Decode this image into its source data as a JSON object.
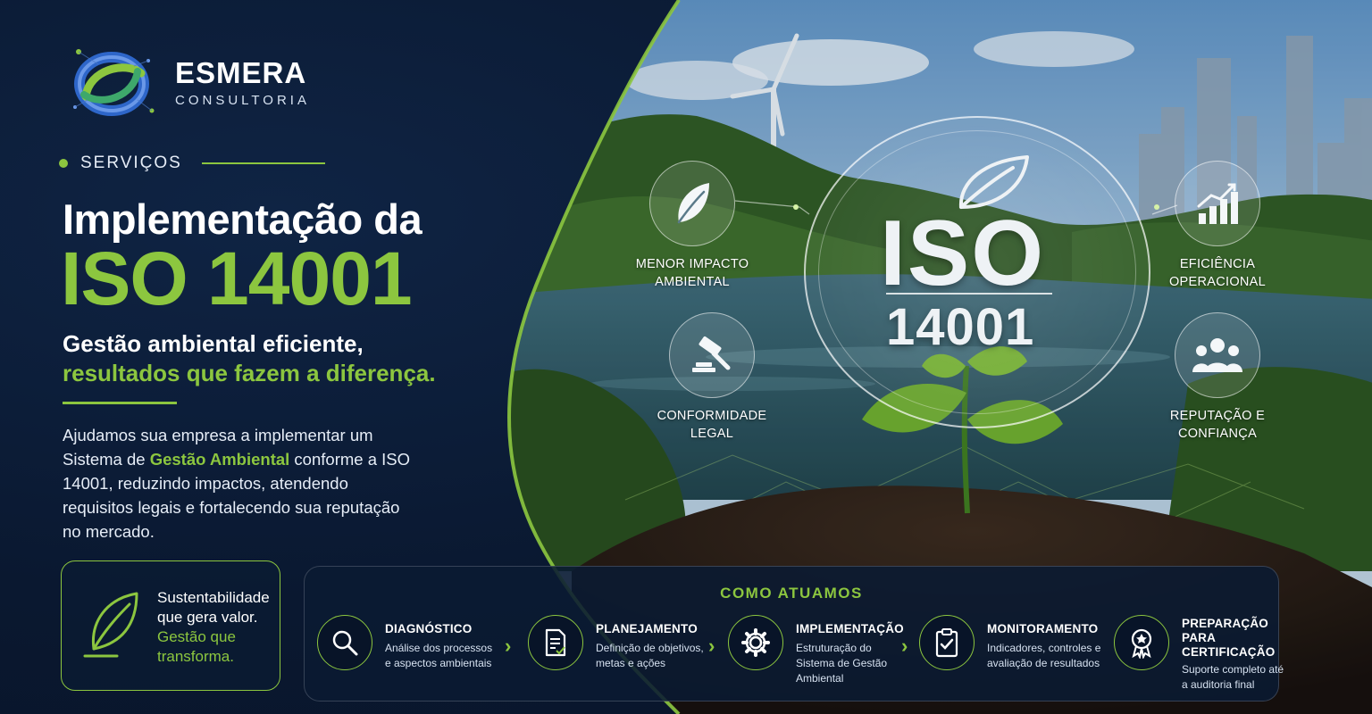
{
  "brand": {
    "name": "ESMERA",
    "tagline": "CONSULTORIA"
  },
  "hero": {
    "eyebrow": "SERVIÇOS",
    "title_line1": "Implementação da",
    "title_line2": "ISO 14001",
    "subtitle_line1": "Gestão ambiental eficiente,",
    "subtitle_line2": "resultados que fazem a diferença.",
    "paragraph_before": "Ajudamos sua empresa a implementar um Sistema de ",
    "paragraph_highlight": "Gestão Ambiental",
    "paragraph_after": " conforme a ISO 14001, reduzindo impactos, atendendo requisitos legais e fortalecendo sua reputação no mercado."
  },
  "sustainability_card": {
    "line1": "Sustentabilidade que gera valor.",
    "line2": "Gestão que transforma.",
    "icon": "leaf-icon"
  },
  "badge": {
    "word": "ISO",
    "number": "14001"
  },
  "benefits": [
    {
      "label": "MENOR IMPACTO AMBIENTAL",
      "icon": "leaf-icon"
    },
    {
      "label": "CONFORMIDADE LEGAL",
      "icon": "gavel-icon"
    },
    {
      "label": "EFICIÊNCIA OPERACIONAL",
      "icon": "growth-chart-icon"
    },
    {
      "label": "REPUTAÇÃO E CONFIANÇA",
      "icon": "people-icon"
    }
  ],
  "process": {
    "title": "COMO ATUAMOS",
    "steps": [
      {
        "name": "DIAGNÓSTICO",
        "desc": "Análise dos processos e aspectos ambientais",
        "icon": "search-icon"
      },
      {
        "name": "PLANEJAMENTO",
        "desc": "Definição de objetivos, metas e ações",
        "icon": "document-icon"
      },
      {
        "name": "IMPLEMENTAÇÃO",
        "desc": "Estruturação do Sistema de Gestão Ambiental",
        "icon": "gear-icon"
      },
      {
        "name": "MONITORAMENTO",
        "desc": "Indicadores, controles e avaliação de resultados",
        "icon": "clipboard-check-icon"
      },
      {
        "name": "PREPARAÇÃO PARA CERTIFICAÇÃO",
        "desc": "Suporte completo até a auditoria final",
        "icon": "award-icon"
      }
    ]
  },
  "colors": {
    "accent": "#8cc63f",
    "background": "#0b1a33",
    "text": "#ffffff"
  }
}
